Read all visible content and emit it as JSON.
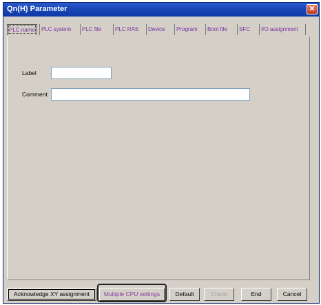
{
  "window": {
    "title": "Qn(H) Parameter",
    "close_label": "✕"
  },
  "tabs": [
    {
      "label": "PLC name",
      "active": true
    },
    {
      "label": "PLC system"
    },
    {
      "label": "PLC file"
    },
    {
      "label": "PLC RAS"
    },
    {
      "label": "Device"
    },
    {
      "label": "Program"
    },
    {
      "label": "Boot file"
    },
    {
      "label": "SFC"
    },
    {
      "label": "I/O assignment"
    }
  ],
  "form": {
    "label_label": "Label",
    "label_value": "",
    "comment_label": "Comment",
    "comment_value": ""
  },
  "buttons": {
    "acknowledge": "Acknowledge XY assignment",
    "multiple_cpu": "Multiple CPU settings",
    "default": "Default",
    "check": "Check",
    "end": "End",
    "cancel": "Cancel"
  },
  "colors": {
    "title_bar": "#1a47b8",
    "tab_text": "#7b2e9e",
    "dialog_bg": "#d4d0c8"
  }
}
